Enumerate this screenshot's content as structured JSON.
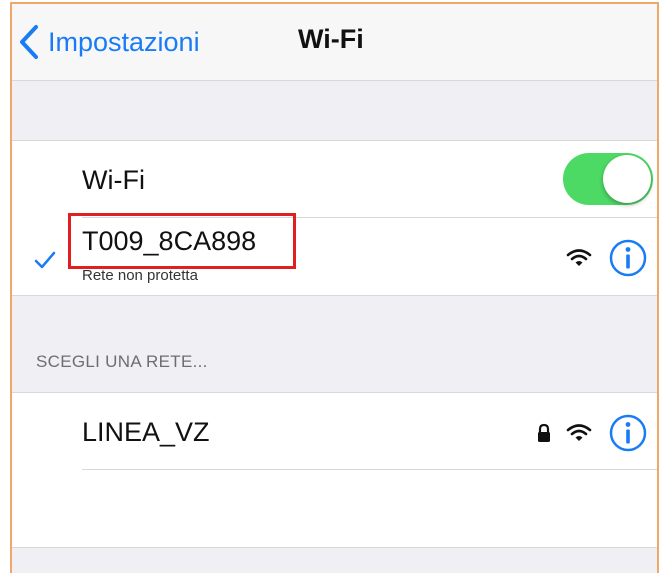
{
  "navbar": {
    "back_label": "Impostazioni",
    "title": "Wi-Fi"
  },
  "wifi_section": {
    "toggle_label": "Wi-Fi",
    "toggle_on": true,
    "connected_network": {
      "name": "T009_8CA898",
      "status": "Rete non protetta",
      "checked": true,
      "icons": [
        "checkmark-icon",
        "wifi-signal-icon",
        "info-icon"
      ]
    }
  },
  "networks_section": {
    "header": "SCEGLI UNA RETE...",
    "networks": [
      {
        "name": "LINEA_VZ",
        "secured": true,
        "icons": [
          "lock-icon",
          "wifi-signal-icon",
          "info-icon"
        ]
      }
    ]
  },
  "colors": {
    "accent": "#1a7cf5",
    "toggle_on": "#4cd964",
    "highlight": "#e02020",
    "frame_border": "#f0a868"
  }
}
